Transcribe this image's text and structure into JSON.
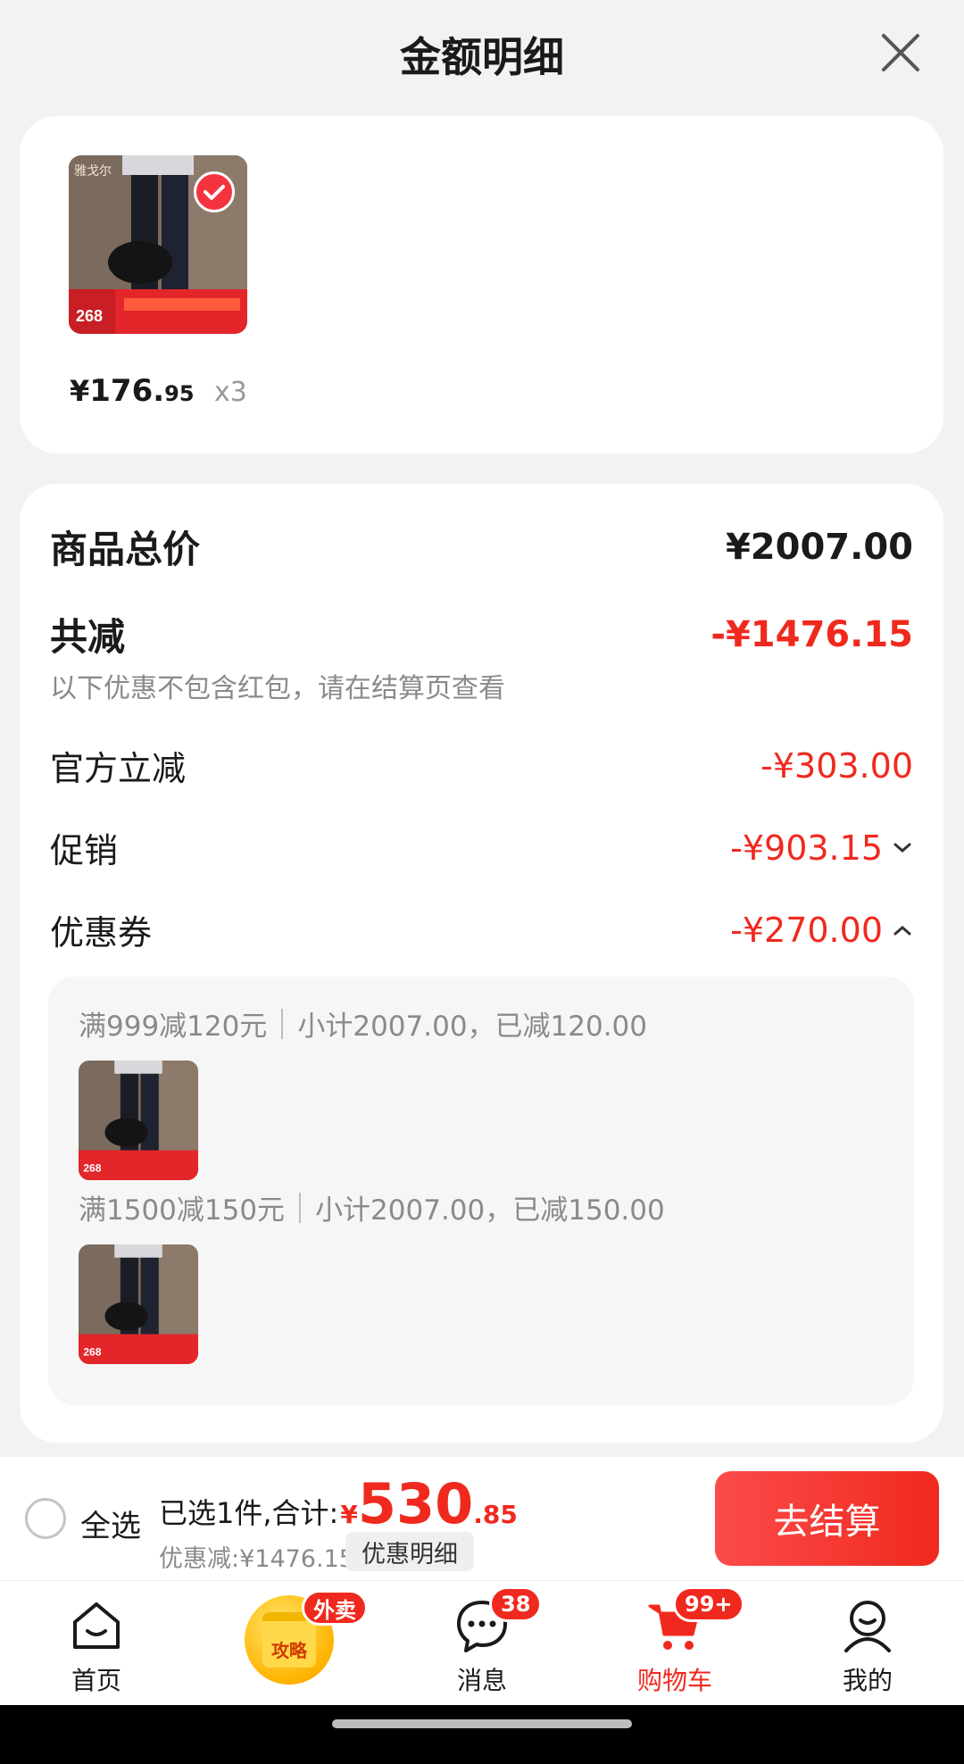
{
  "header": {
    "title": "金额明细"
  },
  "product": {
    "price_symbol": "¥",
    "price_int": "176.",
    "price_dec": "95",
    "quantity": "x3",
    "thumb_text": "268"
  },
  "summary": {
    "total_label": "商品总价",
    "total_value": "¥2007.00",
    "reduced_label": "共减",
    "reduced_value": "-¥1476.15",
    "note": "以下优惠不包含红包，请在结算页查看",
    "official_label": "官方立减",
    "official_value": "-¥303.00",
    "promo_label": "促销",
    "promo_value": "-¥903.15",
    "coupon_label": "优惠券",
    "coupon_value": "-¥270.00"
  },
  "coupons": [
    {
      "title": "满999减120元",
      "detail": "小计2007.00，已减120.00"
    },
    {
      "title": "满1500减150元",
      "detail": "小计2007.00，已减150.00"
    }
  ],
  "checkout": {
    "select_all": "全选",
    "selected_prefix": "已选1件,合计:",
    "total_symbol": "¥",
    "total_int": "530",
    "total_dec": ".85",
    "discount_text": "优惠减:¥1476.15",
    "detail_chip": "优惠明细",
    "button": "去结算"
  },
  "tabbar": {
    "home": "首页",
    "promo_badge": "外卖",
    "promo_text": "攻略",
    "messages": "消息",
    "messages_badge": "38",
    "cart": "购物车",
    "cart_badge": "99+",
    "mine": "我的"
  },
  "colors": {
    "accent": "#f0291e",
    "background": "#f2f2f2"
  }
}
